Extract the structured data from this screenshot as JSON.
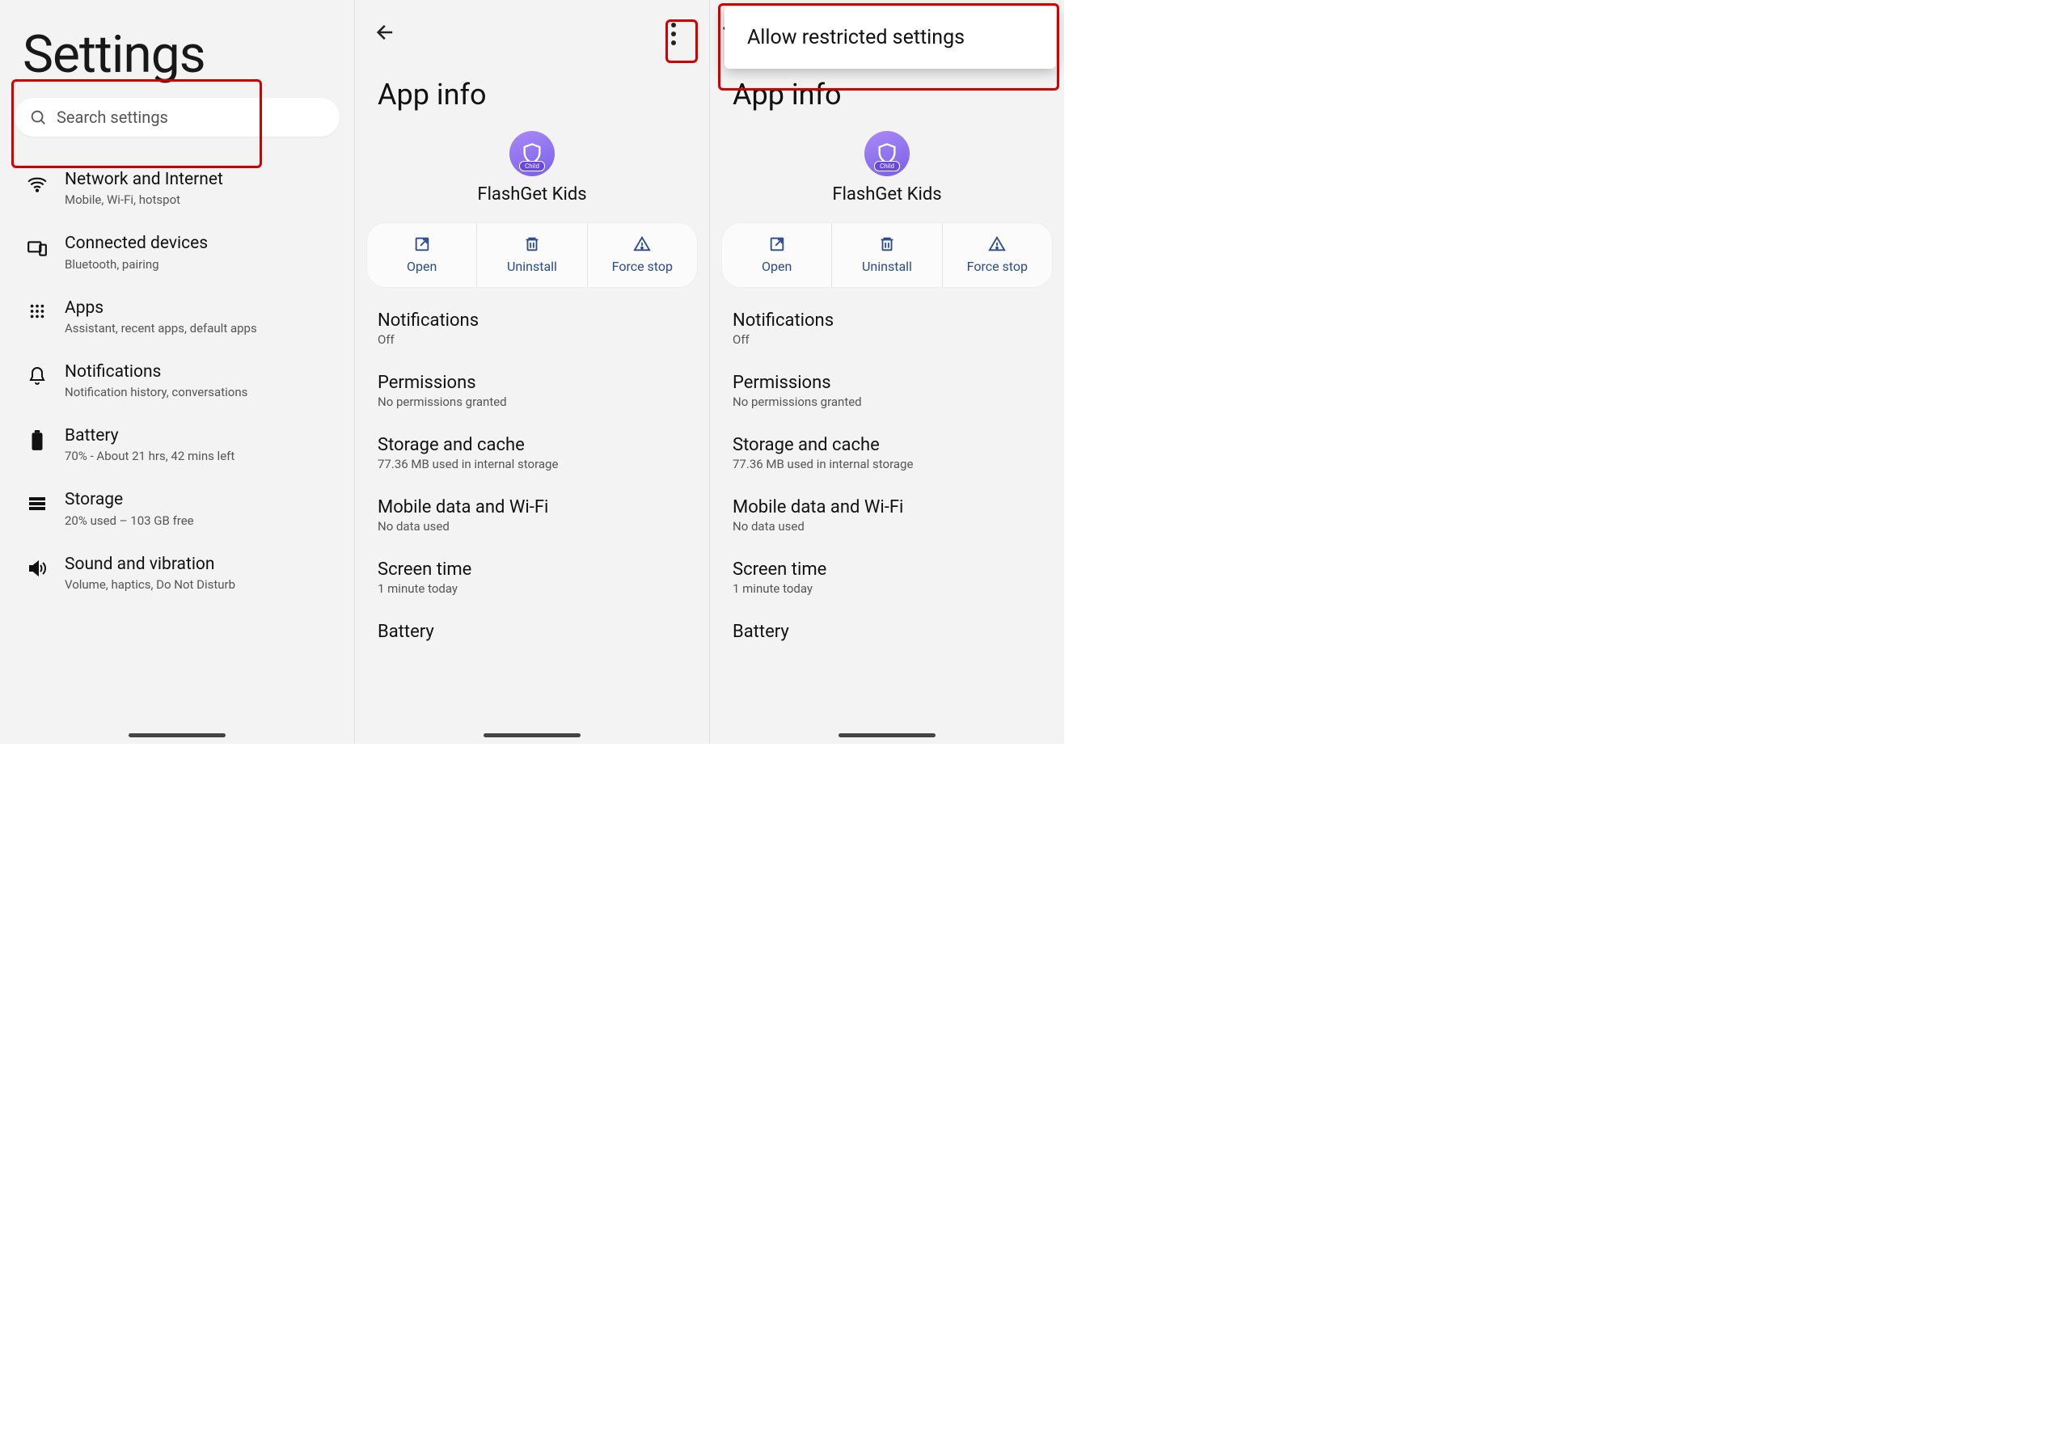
{
  "pane1": {
    "title": "Settings",
    "search_placeholder": "Search settings",
    "items": [
      {
        "title": "Network and Internet",
        "sub": "Mobile, Wi-Fi, hotspot"
      },
      {
        "title": "Connected devices",
        "sub": "Bluetooth, pairing"
      },
      {
        "title": "Apps",
        "sub": "Assistant, recent apps, default apps"
      },
      {
        "title": "Notifications",
        "sub": "Notification history, conversations"
      },
      {
        "title": "Battery",
        "sub": "70% - About 21 hrs, 42 mins left"
      },
      {
        "title": "Storage",
        "sub": "20% used – 103 GB free"
      },
      {
        "title": "Sound and vibration",
        "sub": "Volume, haptics, Do Not Disturb"
      }
    ]
  },
  "appinfo": {
    "title": "App info",
    "app_name": "FlashGet Kids",
    "child_label": "Child",
    "open": "Open",
    "uninstall": "Uninstall",
    "force_stop": "Force stop",
    "opts": [
      {
        "t": "Notifications",
        "s": "Off"
      },
      {
        "t": "Permissions",
        "s": "No permissions granted"
      },
      {
        "t": "Storage and cache",
        "s": "77.36 MB used in internal storage"
      },
      {
        "t": "Mobile data and Wi-Fi",
        "s": "No data used"
      },
      {
        "t": "Screen time",
        "s": "1 minute today"
      },
      {
        "t": "Battery",
        "s": ""
      }
    ]
  },
  "menu": {
    "allow_restricted": "Allow restricted settings"
  }
}
